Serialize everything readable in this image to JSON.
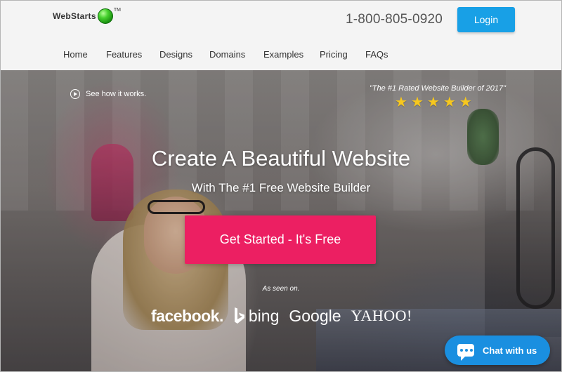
{
  "header": {
    "logo_text": "WebStarts",
    "logo_tm": "TM",
    "phone": "1-800-805-0920",
    "login_label": "Login"
  },
  "nav": {
    "items": [
      {
        "label": "Home"
      },
      {
        "label": "Features"
      },
      {
        "label": "Designs"
      },
      {
        "label": "Domains"
      },
      {
        "label": "Examples"
      },
      {
        "label": "Pricing"
      },
      {
        "label": "FAQs"
      }
    ]
  },
  "hero": {
    "see_how": "See how it works.",
    "rating_quote": "\"The #1 Rated Website Builder of 2017\"",
    "stars": 5,
    "star_color": "#f7c81e",
    "headline": "Create A Beautiful Website",
    "subheadline": "With The #1 Free Website Builder",
    "cta_label": "Get Started - It's Free",
    "cta_color": "#ec1f62",
    "seen_on": "As seen on.",
    "press": {
      "facebook": "facebook.",
      "bing": "bing",
      "google": "Google",
      "yahoo": "YAHOO!"
    }
  },
  "chat": {
    "label": "Chat with us",
    "color": "#1a8fe0"
  },
  "accent": {
    "login_blue": "#18a0e6"
  }
}
